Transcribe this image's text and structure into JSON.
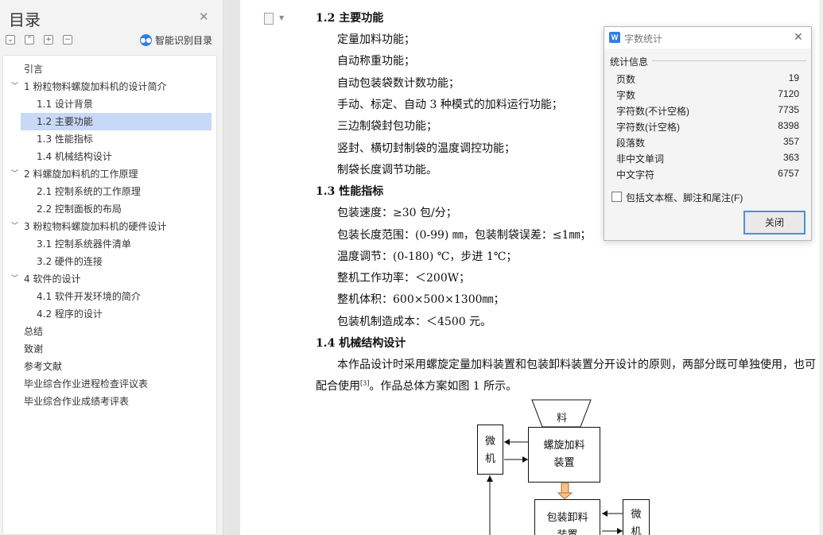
{
  "toc": {
    "title": "目录",
    "smart_label": "智能识别目录",
    "items": [
      {
        "text": "引言",
        "level": 0,
        "arrow": false,
        "selected": false
      },
      {
        "text": "1 粉粒物料螺旋加料机的设计简介",
        "level": 0,
        "arrow": true,
        "selected": false
      },
      {
        "text": "1.1 设计背景",
        "level": 1,
        "arrow": false,
        "selected": false
      },
      {
        "text": "1.2 主要功能",
        "level": 1,
        "arrow": false,
        "selected": true
      },
      {
        "text": "1.3 性能指标",
        "level": 1,
        "arrow": false,
        "selected": false
      },
      {
        "text": "1.4 机械结构设计",
        "level": 1,
        "arrow": false,
        "selected": false
      },
      {
        "text": "2 料螺旋加料机的工作原理",
        "level": 0,
        "arrow": true,
        "selected": false
      },
      {
        "text": "2.1 控制系统的工作原理",
        "level": 1,
        "arrow": false,
        "selected": false
      },
      {
        "text": "2.2 控制面板的布局",
        "level": 1,
        "arrow": false,
        "selected": false
      },
      {
        "text": "3 粉粒物料螺旋加料机的硬件设计",
        "level": 0,
        "arrow": true,
        "selected": false
      },
      {
        "text": "3.1 控制系统器件清单",
        "level": 1,
        "arrow": false,
        "selected": false
      },
      {
        "text": "3.2 硬件的连接",
        "level": 1,
        "arrow": false,
        "selected": false
      },
      {
        "text": "4 软件的设计",
        "level": 0,
        "arrow": true,
        "selected": false
      },
      {
        "text": "4.1 软件开发环境的简介",
        "level": 1,
        "arrow": false,
        "selected": false
      },
      {
        "text": "4.2 程序的设计",
        "level": 1,
        "arrow": false,
        "selected": false
      },
      {
        "text": "总结",
        "level": 0,
        "arrow": false,
        "selected": false
      },
      {
        "text": "致谢",
        "level": 0,
        "arrow": false,
        "selected": false
      },
      {
        "text": "参考文献",
        "level": 0,
        "arrow": false,
        "selected": false
      },
      {
        "text": "毕业综合作业进程检查评议表",
        "level": 0,
        "arrow": false,
        "selected": false
      },
      {
        "text": "毕业综合作业成绩考评表",
        "level": 0,
        "arrow": false,
        "selected": false
      }
    ]
  },
  "doc": {
    "h12": "1.2 主要功能",
    "funcs": [
      "定量加料功能；",
      "自动称重功能；",
      "自动包装袋数计数功能；",
      "手动、标定、自动 3 种模式的加料运行功能；",
      "三边制袋封包功能；",
      "竖封、横切封制袋的温度调控功能；",
      "制袋长度调节功能。"
    ],
    "h13": "1.3 性能指标",
    "perf": [
      "包装速度：≥30 包/分；",
      "包装长度范围：(0-99) ㎜，包装制袋误差：≤1㎜；",
      "温度调节：(0-180) ℃，步进 1℃；",
      "整机工作功率：＜200W；",
      "整机体积：600×500×1300㎜；",
      "包装机制造成本：＜4500 元。"
    ],
    "h14": "1.4 机械结构设计",
    "para1": "本作品设计时采用螺旋定量加料装置和包装卸料装置分开设计的原则，两部分既可单独使用，也可",
    "para2a": "配合使用",
    "para2ref": "[3]",
    "para2b": "。作品总体方案如图 1 所示。",
    "diagram": {
      "hopper": "料",
      "micro1_a": "微",
      "micro1_b": "机",
      "feeder_a": "螺旋加料",
      "feeder_b": "装置",
      "packer_a": "包装卸料",
      "packer_b": "装置",
      "micro2_a": "微",
      "micro2_b": "机"
    }
  },
  "dialog": {
    "title": "字数统计",
    "section": "统计信息",
    "stats": [
      {
        "label": "页数",
        "value": "19"
      },
      {
        "label": "字数",
        "value": "7120"
      },
      {
        "label": "字符数(不计空格)",
        "value": "7735"
      },
      {
        "label": "字符数(计空格)",
        "value": "8398"
      },
      {
        "label": "段落数",
        "value": "357"
      },
      {
        "label": "非中文单词",
        "value": "363"
      },
      {
        "label": "中文字符",
        "value": "6757"
      }
    ],
    "checkbox_label": "包括文本框、脚注和尾注(F)",
    "close_label": "关闭"
  }
}
